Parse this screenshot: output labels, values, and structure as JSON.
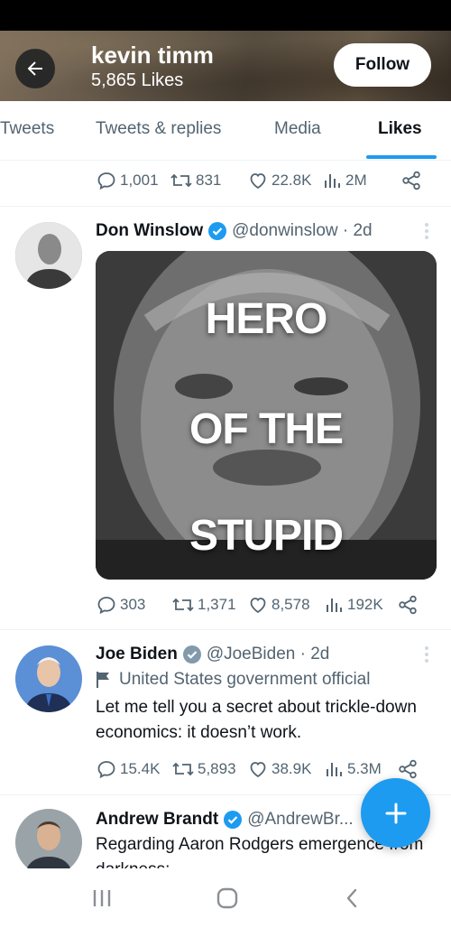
{
  "header": {
    "profile_name": "kevin timm",
    "likes_count": "5,865 Likes",
    "follow_label": "Follow"
  },
  "tabs": [
    {
      "label": "Tweets",
      "active": false
    },
    {
      "label": "Tweets & replies",
      "active": false
    },
    {
      "label": "Media",
      "active": false
    },
    {
      "label": "Likes",
      "active": true
    }
  ],
  "tweets": [
    {
      "stats": {
        "replies": "1,001",
        "retweets": "831",
        "likes": "22.8K",
        "views": "2M"
      }
    },
    {
      "author": "Don Winslow",
      "verified": true,
      "handle": "@donwinslow · 2d",
      "media_caption": [
        "HERO",
        "OF THE",
        "STUPID"
      ],
      "stats": {
        "replies": "303",
        "retweets": "1,371",
        "likes": "8,578",
        "views": "192K"
      }
    },
    {
      "author": "Joe Biden",
      "verified": true,
      "handle": "@JoeBiden · 2d",
      "label": "United States government official",
      "text": "Let me tell you a secret about trickle-down economics: it doesn’t work.",
      "stats": {
        "replies": "15.4K",
        "retweets": "5,893",
        "likes": "38.9K",
        "views": "5.3M"
      }
    },
    {
      "author": "Andrew Brandt",
      "verified": true,
      "handle": "@AndrewBr...",
      "text": "Regarding Aaron Rodgers emergence from darkness:"
    }
  ],
  "colors": {
    "accent": "#1d9bf0",
    "secondary_text": "#536471",
    "verified": "#1d9bf0"
  },
  "icons": [
    "back-arrow-icon",
    "reply-icon",
    "retweet-icon",
    "like-icon",
    "views-icon",
    "share-icon",
    "more-icon",
    "flag-icon",
    "compose-icon",
    "recents-icon",
    "home-icon",
    "back-icon"
  ]
}
